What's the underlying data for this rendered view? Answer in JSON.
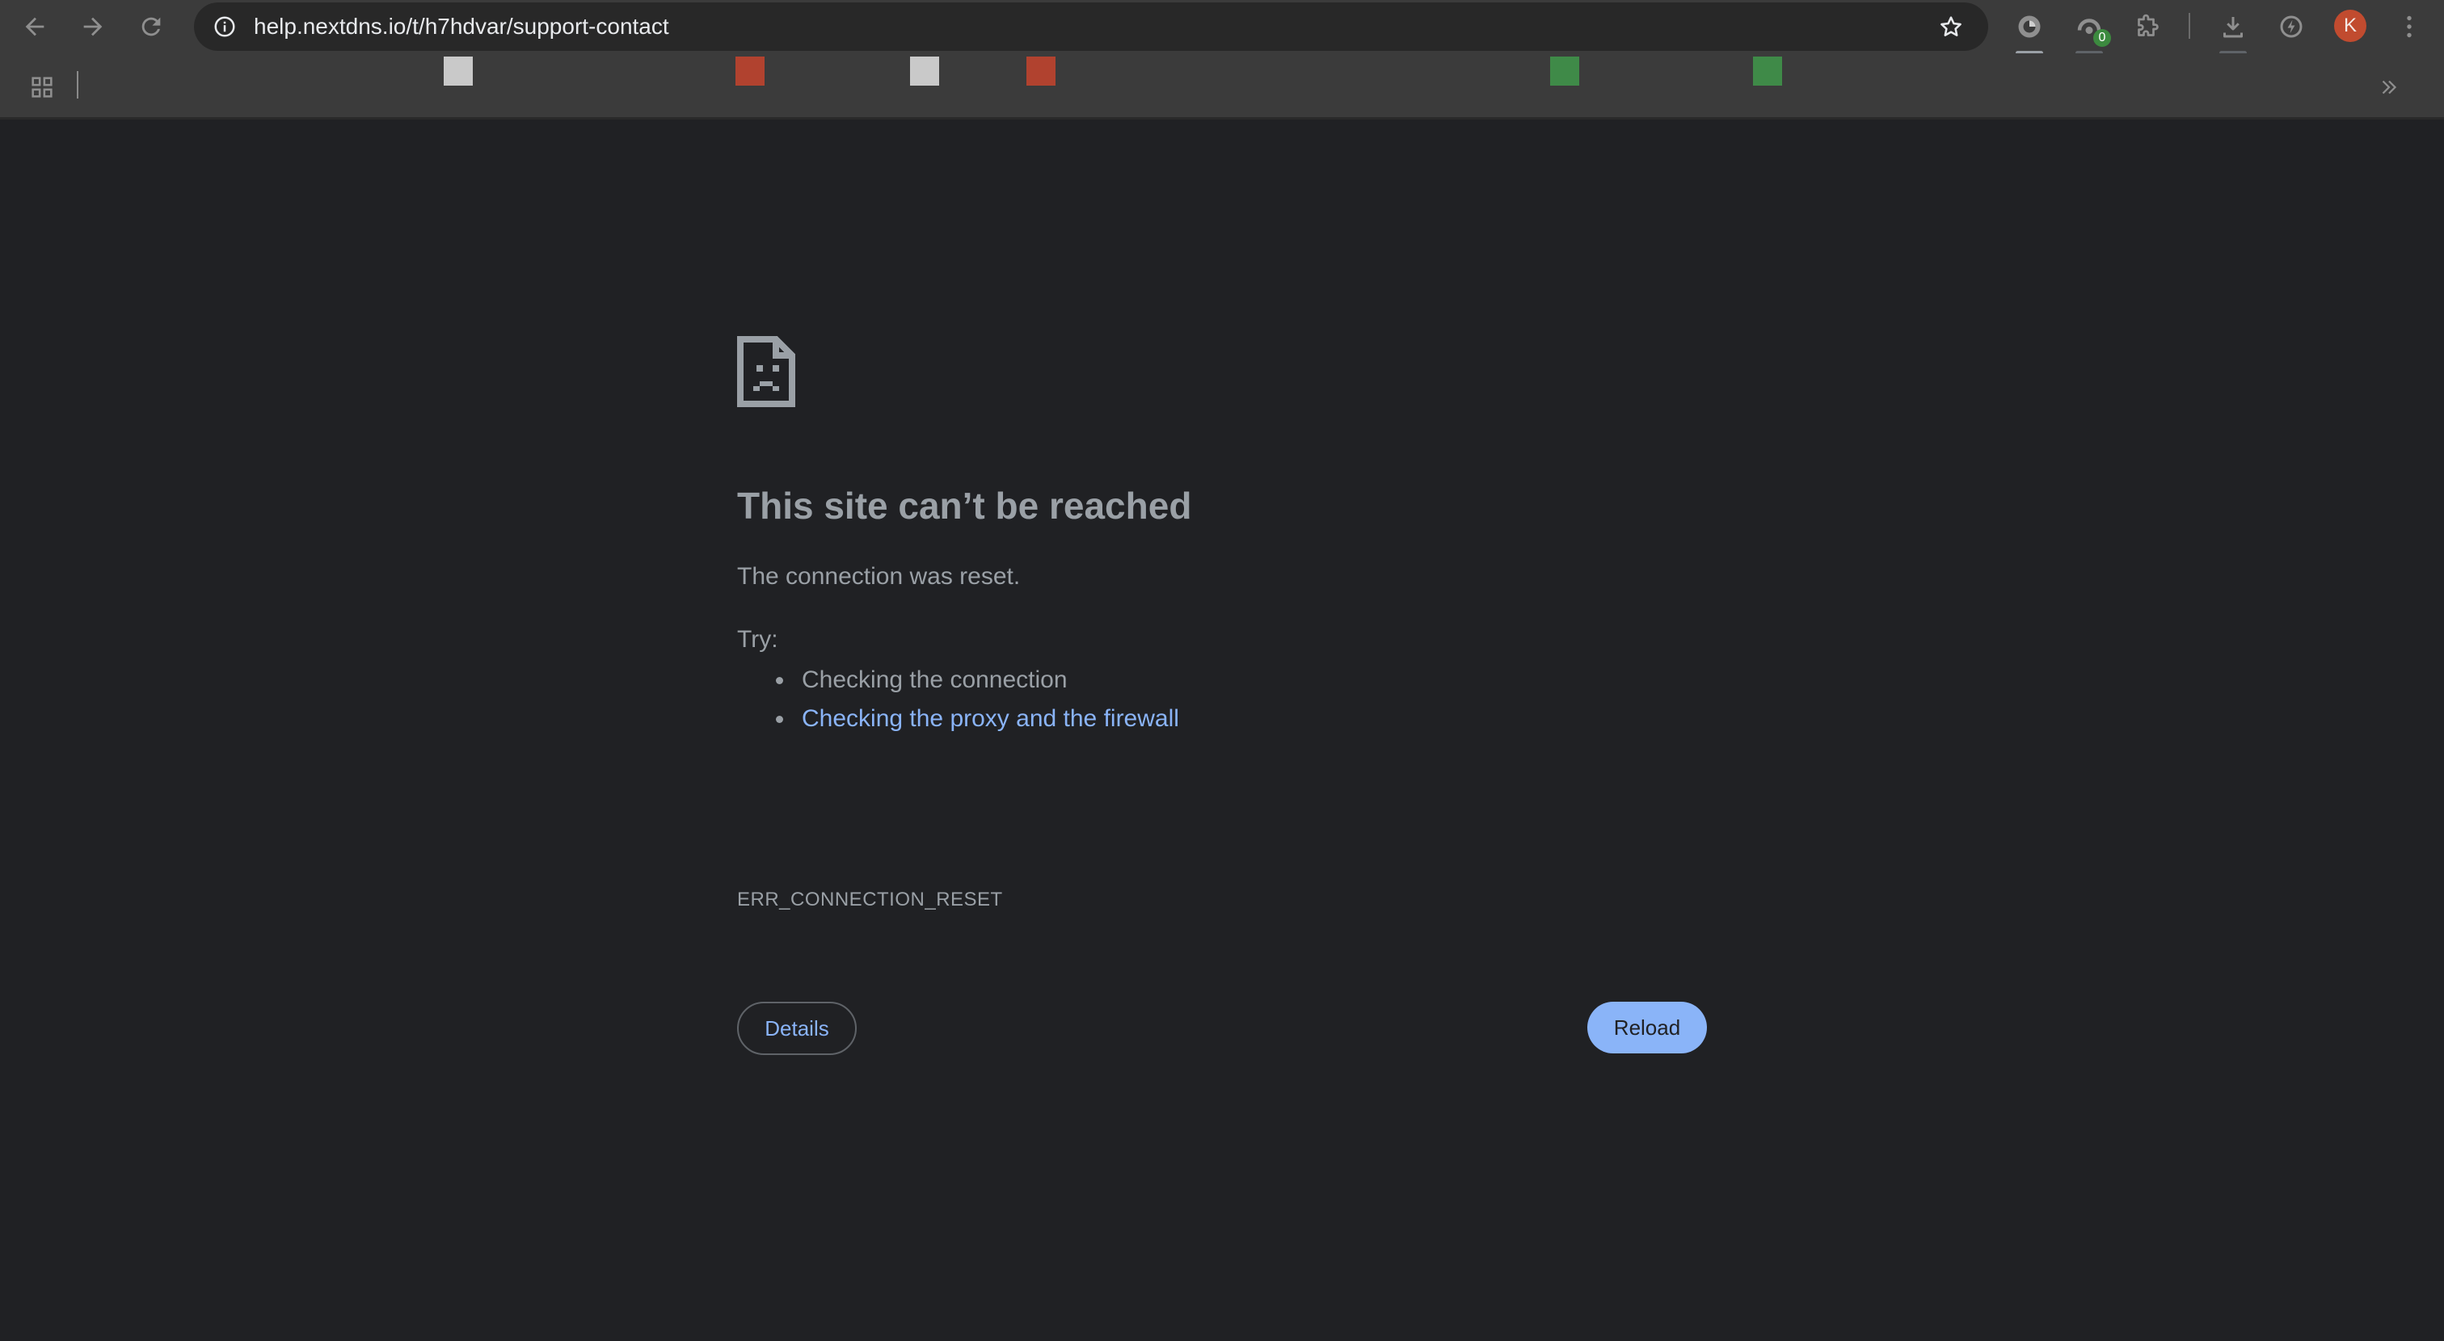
{
  "browser": {
    "url": "help.nextdns.io/t/h7hdvar/support-contact",
    "profile_initial": "K",
    "accent_colors": {
      "toolbar_bg": "#3b3b3b",
      "omnibox_bg": "#282828",
      "page_bg": "#202124",
      "link": "#8ab4f8",
      "avatar": "#c14b2f"
    },
    "extensions": [
      {
        "name": "extension-1-icon",
        "pinned": true
      },
      {
        "name": "extension-2-icon",
        "badge": "0"
      },
      {
        "name": "extensions-puzzle-icon"
      }
    ]
  },
  "bookmarks": [
    {
      "name": "bookmark-favicon-gray-1",
      "color": "#c9c9c9"
    },
    {
      "name": "bookmark-favicon-red-1",
      "color": "#b1422f"
    },
    {
      "name": "bookmark-favicon-gray-2",
      "color": "#c9c9c9"
    },
    {
      "name": "bookmark-favicon-red-2",
      "color": "#b1422f"
    },
    {
      "name": "bookmark-favicon-green-1",
      "color": "#3f8a48"
    },
    {
      "name": "bookmark-favicon-green-2",
      "color": "#3f8a48"
    }
  ],
  "error_page": {
    "title": "This site can’t be reached",
    "message": "The connection was reset.",
    "try_label": "Try:",
    "suggestions": [
      {
        "text": "Checking the connection",
        "is_link": false
      },
      {
        "text": "Checking the proxy and the firewall",
        "is_link": true
      }
    ],
    "error_code": "ERR_CONNECTION_RESET",
    "details_button": "Details",
    "reload_button": "Reload"
  }
}
